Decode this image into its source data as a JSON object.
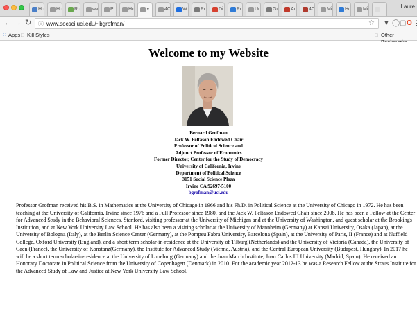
{
  "browser": {
    "tabs": [
      {
        "label": "Hc",
        "favicon_color": "#4a7fc8"
      },
      {
        "label": "Hc",
        "favicon_color": "#9a9a9a"
      },
      {
        "label": "Rc",
        "favicon_color": "#6aa84f"
      },
      {
        "label": "wv",
        "favicon_color": "#9a9a9a"
      },
      {
        "label": "Pr",
        "favicon_color": "#9a9a9a"
      },
      {
        "label": "Hc",
        "favicon_color": "#9a9a9a"
      },
      {
        "label": "×",
        "favicon_color": "#9a9a9a",
        "active": true
      },
      {
        "label": "4C",
        "favicon_color": "#9a9a9a"
      },
      {
        "label": "W.",
        "favicon_color": "#1e6ee0"
      },
      {
        "label": "Pr",
        "favicon_color": "#7a7a7a"
      },
      {
        "label": "Di",
        "favicon_color": "#d6402f"
      },
      {
        "label": "Pr",
        "favicon_color": "#2f7bd6"
      },
      {
        "label": "Ur",
        "favicon_color": "#9a9a9a"
      },
      {
        "label": "Gc",
        "favicon_color": "#7a7a7a"
      },
      {
        "label": "An",
        "favicon_color": "#c0392b"
      },
      {
        "label": "4C",
        "favicon_color": "#b03a2e"
      },
      {
        "label": "Mi",
        "favicon_color": "#9a9a9a"
      },
      {
        "label": "Hc",
        "favicon_color": "#2f7bd6"
      },
      {
        "label": "Mi",
        "favicon_color": "#9a9a9a"
      },
      {
        "label": "",
        "favicon_color": "#dcdcdc"
      }
    ],
    "profile_name": "Laure",
    "url": "www.socsci.uci.edu/~bgrofman/",
    "bookmarks": {
      "apps_label": "Apps",
      "kill_styles_label": "Kill Styles",
      "other_label": "Other Bookmarks"
    },
    "icons": {
      "back": "back-arrow-icon",
      "forward": "forward-arrow-icon",
      "reload": "reload-icon",
      "star": "star-icon",
      "menu": "menu-icon"
    },
    "colors": {
      "link": "#1a0dab",
      "close": "#fc5753",
      "minimize": "#fdbc40",
      "maximize": "#33c748"
    }
  },
  "page": {
    "title": "Welcome to my Website",
    "contact": {
      "name": "Bernard Grofman",
      "chair": "Jack W. Peltason Endowed Chair",
      "title1": "Professor of Political Science and",
      "title2": "Adjunct Professor of Economics",
      "former": "Former Director, Center for the Study of Democracy",
      "university": "University of California, Irvine",
      "department": "Department of Political Science",
      "address": "3151 Social Science Plaza",
      "city": "Irvine CA 92697-5100",
      "email": "bgrofman@uci.edu"
    },
    "bio": "Professor Grofman received his B.S. in Mathematics at the University of Chicago in 1966 and his Ph.D. in Political Science at the University of Chicago in 1972. He has been teaching at the University of California, Irvine since 1976 and a Full Professor since 1980, and the Jack W. Peltason Endowed Chair since 2008. He has been a Fellow at the Center for Advanced Study in the Behavioral Sciences, Stanford, visiting professor at the University of Michigan and at the University of Washington, and quest scholar at the Brookings Institution, and at New York University Law School. He has also been a visiting scholar at the University of Mannheim (Germany) at Kansai University, Osaka (Japan), at the University of Bologna (Italy), at the Berlin Science Center (Germany), at the Pompeu Fabra University, Barcelona (Spain), at the University of Paris, II (France) and at Nuffield College, Oxford University (England), and a short term scholar-in-residence at the University of Tilburg (Netherlands) and the University of Victoria (Canada), the University of Caen (France), the University of Konstanz(Germany), the Institute for Advanced Study (Vienna, Austria), and the Central European University (Budapest, Hungary). In 2017 he will be a short term scholar-in-residence at the University of Luneburg (Germany) and the Juan March Institute, Juan Carlos III University (Madrid, Spain). He received an Honorary Doctorate in Political Science from the University of Copenhagen (Denmark) in 2010. For the academic year 2012-13 he was a Research Fellow at the Straus Institute for the Advanced Study of Law and Justice at New York University Law School."
  }
}
